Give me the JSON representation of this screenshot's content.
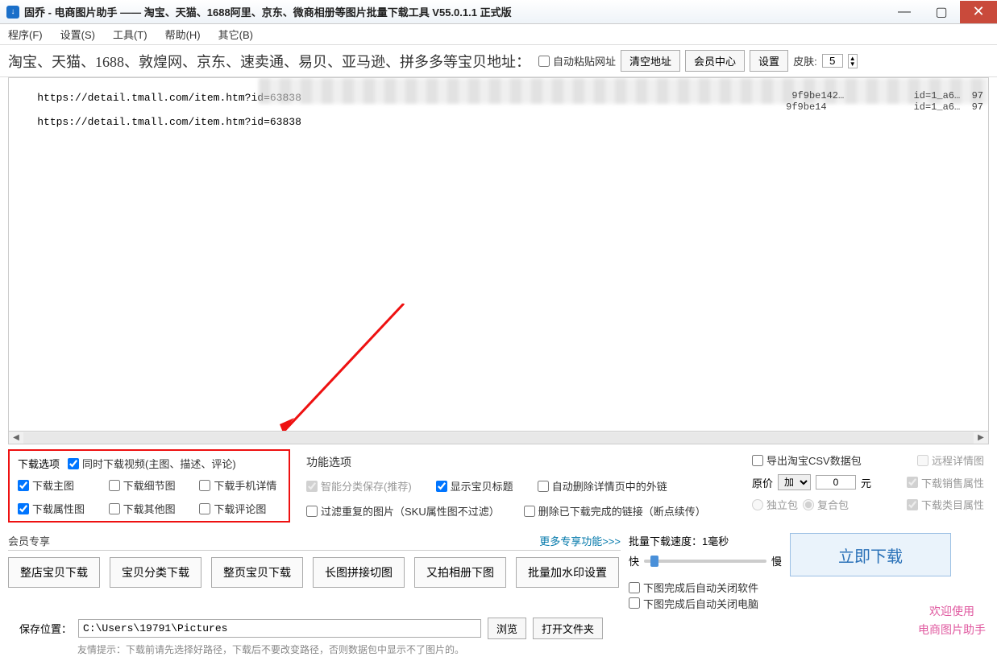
{
  "window": {
    "title": "固乔 - 电商图片助手 —— 淘宝、天猫、1688阿里、京东、微商相册等图片批量下载工具 V55.0.1.1 正式版",
    "icon_glyph": "↓"
  },
  "menu": {
    "program": "程序(F)",
    "settings": "设置(S)",
    "tools": "工具(T)",
    "help": "帮助(H)",
    "other": "其它(B)"
  },
  "toolbar": {
    "url_label": "淘宝、天猫、1688、敦煌网、京东、速卖通、易贝、亚马逊、拼多多等宝贝地址：",
    "auto_paste": "自动粘贴网址",
    "clear": "清空地址",
    "member_center": "会员中心",
    "settings_btn": "设置",
    "skin_label": "皮肤:",
    "skin_value": "5"
  },
  "urls": {
    "line1": "https://detail.tmall.com/item.htm?id=63838",
    "line2": "https://detail.tmall.com/item.htm?id=63838",
    "suffix1": "9f9be142…            id=1_a6…  97",
    "suffix2": "9f9be14               id=1_a6…  97"
  },
  "download_options": {
    "title": "下载选项",
    "simul_video": "同时下载视频(主图、描述、评论)",
    "main_img": "下载主图",
    "detail_img": "下载细节图",
    "mobile_detail": "下载手机详情",
    "attr_img": "下载属性图",
    "other_img": "下载其他图",
    "comment_img": "下载评论图"
  },
  "func_options": {
    "title": "功能选项",
    "smart_save": "智能分类保存(推荐)",
    "show_title": "显示宝贝标题",
    "auto_remove_ext": "自动删除详情页中的外链",
    "filter_dup": "过滤重复的图片（SKU属性图不过滤）",
    "remove_done": "删除已下载完成的链接（断点续传）"
  },
  "rightcol": {
    "export_csv": "导出淘宝CSV数据包",
    "remote_detail": "远程详情图",
    "price_label": "原价",
    "price_op": "加",
    "price_val": "0",
    "price_unit": "元",
    "dl_sale_attr": "下载销售属性",
    "pack_single": "独立包",
    "pack_compound": "复合包",
    "dl_cat_attr": "下载类目属性"
  },
  "member": {
    "label": "会员专享",
    "more": "更多专享功能>>>",
    "whole_shop": "整店宝贝下载",
    "classify": "宝贝分类下载",
    "whole_page": "整页宝贝下载",
    "long_img": "长图拼接切图",
    "album": "又拍相册下图",
    "watermark": "批量加水印设置"
  },
  "speed": {
    "label": "批量下载速度：1毫秒",
    "fast": "快",
    "slow": "慢"
  },
  "autoclose": {
    "close_soft": "下图完成后自动关闭软件",
    "close_pc": "下图完成后自动关闭电脑"
  },
  "download_now": "立即下载",
  "save": {
    "label": "保存位置：",
    "path": "C:\\Users\\19791\\Pictures",
    "browse": "浏览",
    "open_folder": "打开文件夹"
  },
  "hint": "友情提示：下载前请先选择好路径，下载后不要改变路径，否则数据包中显示不了图片的。",
  "rightfoot": {
    "l1": "欢迎使用",
    "l2": "电商图片助手"
  }
}
